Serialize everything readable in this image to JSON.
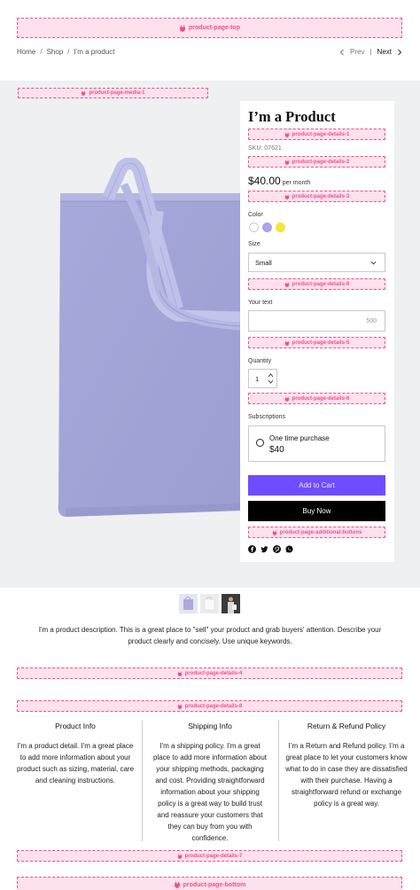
{
  "slots": {
    "top": "product-page-top",
    "media1": "product-page-media-1",
    "details1": "product-page-details-1",
    "details2": "product-page-details-2",
    "details3": "product-page-details-3",
    "details9": "product-page-details-9",
    "details5": "product-page-details-5",
    "details6": "product-page-details-6",
    "additional_buttons": "product-page-additional-buttons",
    "details4": "product-page-details-4",
    "details8": "product-page-details-8",
    "details7": "product-page-details-7",
    "bottom": "product-page-bottom"
  },
  "breadcrumb": {
    "home": "Home",
    "sep": "/",
    "shop": "Shop",
    "current": "I'm a product"
  },
  "pager": {
    "prev": "Prev",
    "divider": "|",
    "next": "Next"
  },
  "product": {
    "title": "I’m a Product",
    "sku": "SKU: 07621",
    "price": "$40.00",
    "price_unit": "per month"
  },
  "options": {
    "color_label": "Color",
    "colors": [
      "#ffffff",
      "#a9a4e8",
      "#f3e63b"
    ],
    "size_label": "Size",
    "size_value": "Small",
    "text_label": "Your text",
    "text_counter": "500",
    "quantity_label": "Quantity",
    "quantity_value": "1",
    "subscriptions_label": "Subscriptions",
    "subscription_option": "One time purchase",
    "subscription_price": "$40"
  },
  "buttons": {
    "add_to_cart": "Add to Cart",
    "buy_now": "Buy Now"
  },
  "social": [
    "facebook-icon",
    "twitter-icon",
    "pinterest-icon",
    "whatsapp-icon"
  ],
  "description": "I'm a product description. This is a great place to \"sell\" your product and grab buyers' attention. Describe your product clearly and concisely. Use unique keywords.",
  "info": [
    {
      "title": "Product Info",
      "text": "I'm a product detail. I'm a great place to add more information about your product such as sizing, material, care and cleaning instructions."
    },
    {
      "title": "Shipping Info",
      "text": "I'm a shipping policy. I'm a great place to add more information about your shipping methods, packaging and cost. Providing straightforward information about your shipping policy is a great way to build trust and reassure your customers that they can buy from you with confidence."
    },
    {
      "title": "Return & Refund Policy",
      "text": "I’m a Return and Refund policy. I’m a great place to let your customers know what to do in case they are dissatisfied with their purchase. Having a straightforward refund or exchange policy is a great way."
    }
  ],
  "colors": {
    "accent": "#6f4cff",
    "slot_border": "#f0508c",
    "slot_bg": "#fde1ec",
    "bag": "#a9abdc"
  }
}
